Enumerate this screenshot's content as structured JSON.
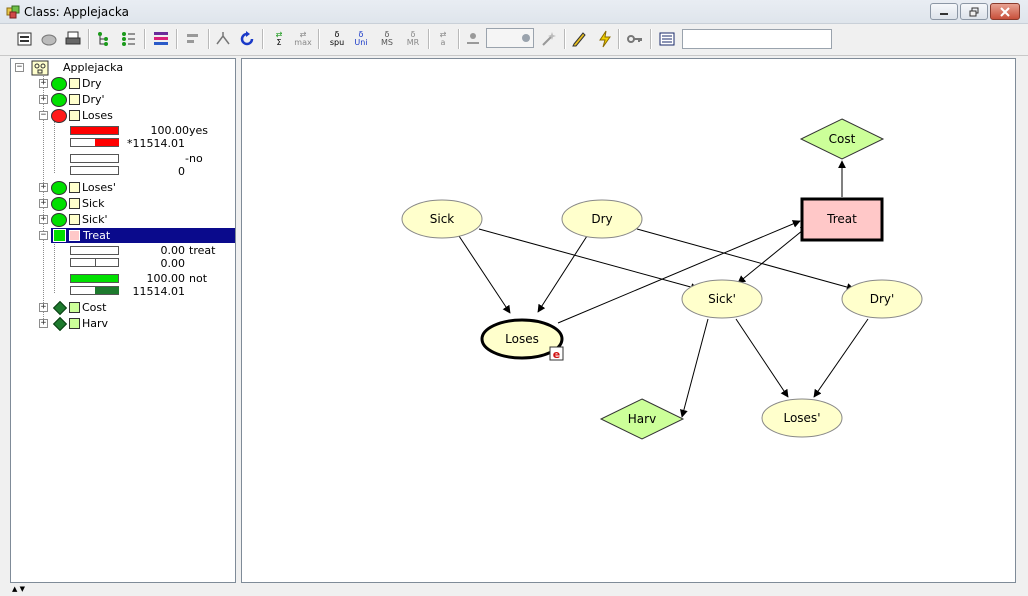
{
  "window": {
    "title": "Class: Applejacka"
  },
  "toolbar": {
    "buttons": [
      {
        "name": "properties-icon"
      },
      {
        "name": "compile-icon"
      },
      {
        "name": "print-icon"
      },
      {
        "name": "expand-tree-icon"
      },
      {
        "name": "collapse-tree-icon"
      },
      {
        "name": "monitor-bars-icon"
      },
      {
        "name": "align-icon"
      },
      {
        "name": "retract-icon"
      },
      {
        "name": "propagate-icon"
      },
      {
        "name": "sum-propagate-icon",
        "label": "Σ"
      },
      {
        "name": "max-propagate-icon",
        "label": "max"
      },
      {
        "name": "spu-icon",
        "label": "spu"
      },
      {
        "name": "uni-icon",
        "label": "Uni"
      },
      {
        "name": "ms-icon",
        "label": "MS"
      },
      {
        "name": "mr-icon",
        "label": "MR"
      },
      {
        "name": "a-icon",
        "label": "a"
      },
      {
        "name": "wizard-icon"
      },
      {
        "name": "pencil-icon"
      },
      {
        "name": "lightning-icon"
      },
      {
        "name": "key-icon"
      },
      {
        "name": "keyboard-icon"
      }
    ],
    "search_value": ""
  },
  "tree": {
    "root": "Applejacka",
    "nodes": {
      "dry": "Dry",
      "dry_prime": "Dry'",
      "loses": {
        "label": "Loses",
        "states": [
          {
            "value": "100.00",
            "state": "yes",
            "sub": "*11514.01",
            "bar": 100
          },
          {
            "value": "-",
            "state": "no",
            "sub": "0",
            "bar": 0
          }
        ]
      },
      "loses_prime": "Loses'",
      "sick": "Sick",
      "sick_prime": "Sick'",
      "treat": {
        "label": "Treat",
        "states": [
          {
            "value": "0.00",
            "state": "treat",
            "sub": "0.00",
            "bar": 0
          },
          {
            "value": "100.00",
            "state": "not",
            "sub": "11514.01",
            "bar": 100
          }
        ]
      },
      "cost": "Cost",
      "harv": "Harv"
    }
  },
  "graph": {
    "nodes": {
      "cost": "Cost",
      "treat": "Treat",
      "sick": "Sick",
      "dry": "Dry",
      "sick_prime": "Sick'",
      "dry_prime": "Dry'",
      "loses": "Loses",
      "harv": "Harv",
      "loses_prime": "Loses'",
      "evidence_badge": "e"
    }
  },
  "colors": {
    "chance_node": "#ffffcc",
    "decision_node": "#ffc8c8",
    "utility_node": "#ccff99",
    "bar_red": "#ff0000",
    "bar_green": "#00e000",
    "selection": "#0a0a8c"
  }
}
